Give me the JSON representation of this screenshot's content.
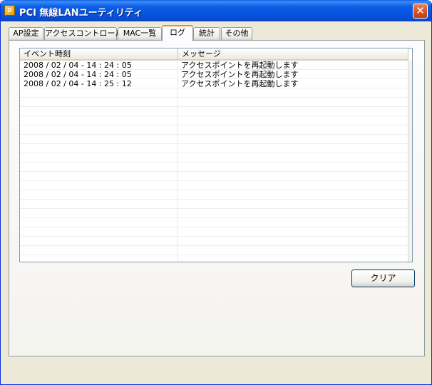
{
  "window": {
    "title": "PCI 無線LANユーティリティ",
    "close_label": "✕",
    "icon_glyph": "D"
  },
  "tabs": [
    {
      "label": "AP設定"
    },
    {
      "label": "アクセスコントロール"
    },
    {
      "label": "MAC一覧"
    },
    {
      "label": "ログ"
    },
    {
      "label": "統計"
    },
    {
      "label": "その他"
    }
  ],
  "log": {
    "columns": [
      "イベント時刻",
      "メッセージ"
    ],
    "rows": [
      {
        "time": "2008 / 02 / 04 - 14 : 24 : 05",
        "message": "アクセスポイントを再起動します"
      },
      {
        "time": "2008 / 02 / 04 - 14 : 24 : 05",
        "message": "アクセスポイントを再起動します"
      },
      {
        "time": "2008 / 02 / 04 - 14 : 25 : 12",
        "message": "アクセスポイントを再起動します"
      }
    ]
  },
  "buttons": {
    "clear_label": "クリア"
  },
  "colors": {
    "accent_tab": "#e68b2c",
    "titlebar": "#0553dd",
    "close": "#d2501e"
  }
}
